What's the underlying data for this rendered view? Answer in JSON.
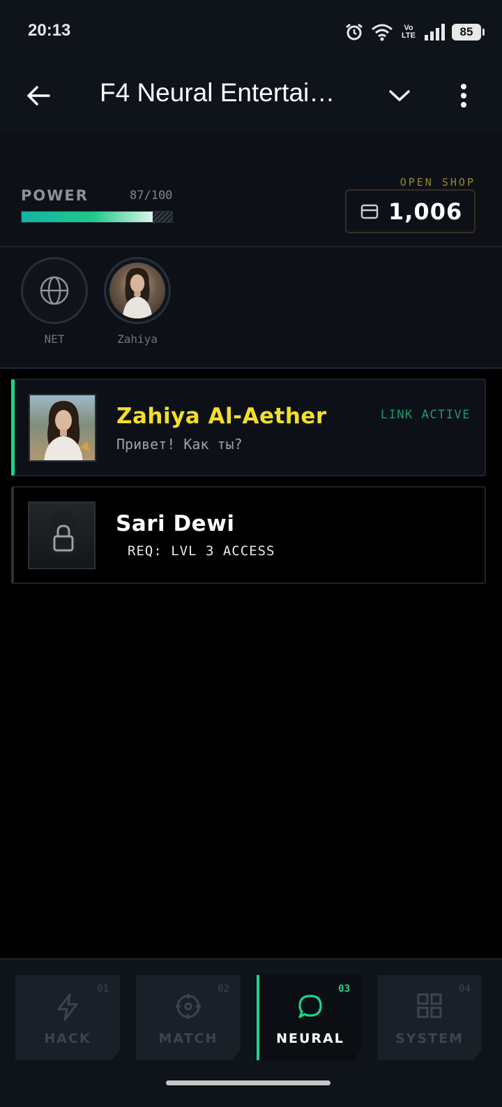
{
  "status_bar": {
    "time": "20:13",
    "network": "Vo LTE",
    "battery": "85"
  },
  "app_bar": {
    "title": "F4 Neural Entertai…"
  },
  "power": {
    "label": "POWER",
    "value_text": "87/100",
    "level": 0.87
  },
  "shop": {
    "label": "OPEN SHOP",
    "currency": "1,006"
  },
  "stories": [
    {
      "label": "NET",
      "icon": "globe-icon"
    },
    {
      "label": "Zahiya",
      "icon": "avatar"
    }
  ],
  "chats": [
    {
      "name": "Zahiya Al-Aether",
      "message": "Привет! Как ты?",
      "status": "LINK ACTIVE"
    },
    {
      "name": "Sari Dewi",
      "requirement": "REQ: LVL 3 ACCESS",
      "icon": "lock-icon"
    }
  ],
  "nav": [
    {
      "label": "HACK",
      "num": "01",
      "icon": "lightning-icon"
    },
    {
      "label": "MATCH",
      "num": "02",
      "icon": "crosshair-icon"
    },
    {
      "label": "NEURAL",
      "num": "03",
      "icon": "chat-icon",
      "active": true
    },
    {
      "label": "SYSTEM",
      "num": "04",
      "icon": "grid-icon"
    }
  ],
  "colors": {
    "accent_green": "#1ed28a",
    "name_yellow": "#f2de2b",
    "shop_gold": "#9a8630"
  }
}
